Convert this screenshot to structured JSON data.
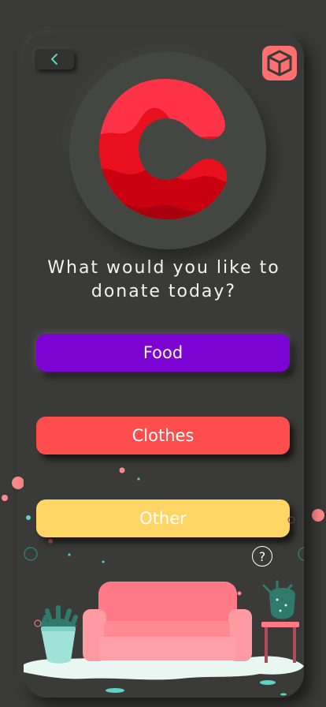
{
  "header": {
    "back_icon": "chevron-left-icon",
    "app_icon": "box-icon",
    "logo": "c-logo"
  },
  "prompt": {
    "line1": "What would you like to",
    "line2": "donate today?"
  },
  "options": [
    {
      "label": "Food",
      "color": "#7b04d3"
    },
    {
      "label": "Clothes",
      "color": "#ff4d4d"
    },
    {
      "label": "Other",
      "color": "#ffd566"
    }
  ],
  "help": {
    "label": "?"
  },
  "colors": {
    "background": "#393a38",
    "accent_teal": "#5fd3c6",
    "accent_coral": "#ff6f6f"
  }
}
